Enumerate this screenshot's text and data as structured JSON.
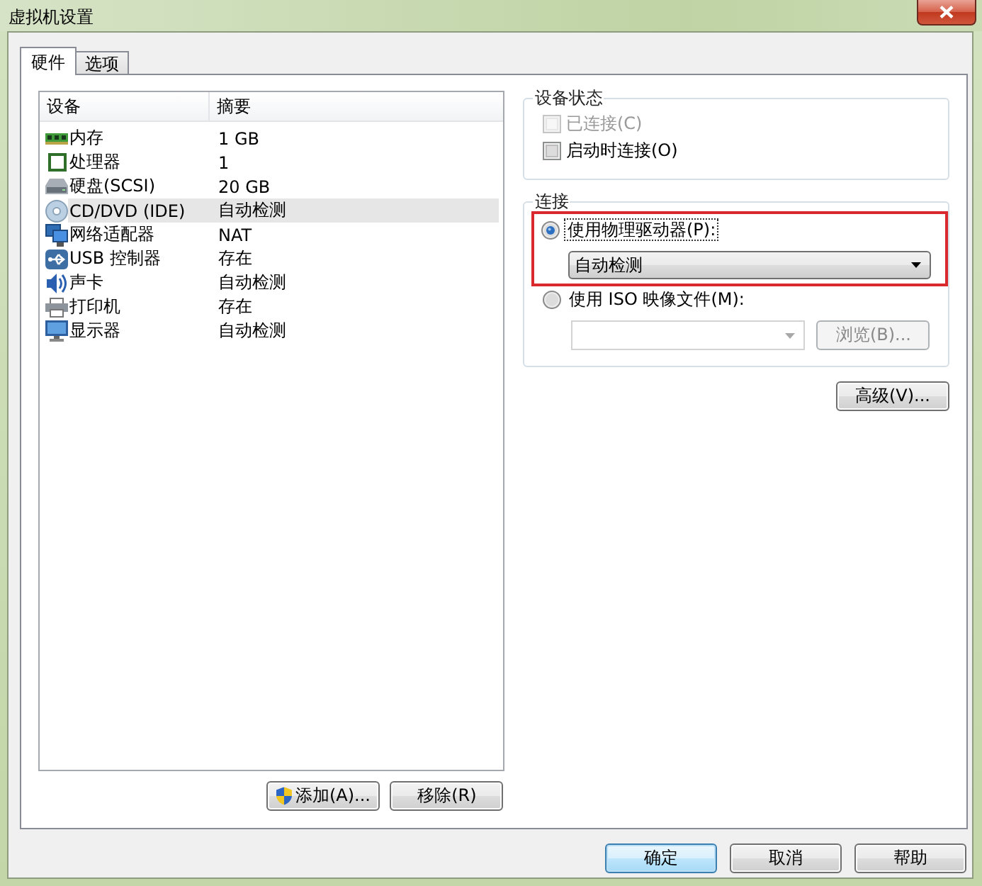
{
  "window": {
    "title": "虚拟机设置"
  },
  "tabs": [
    {
      "label": "硬件",
      "selected": true
    },
    {
      "label": "选项",
      "selected": false
    }
  ],
  "device_list": {
    "columns": [
      "设备",
      "摘要"
    ],
    "rows": [
      {
        "kind": "memory",
        "device": "内存",
        "summary": "1 GB",
        "selected": false
      },
      {
        "kind": "cpu",
        "device": "处理器",
        "summary": "1",
        "selected": false
      },
      {
        "kind": "disk",
        "device": "硬盘(SCSI)",
        "summary": "20 GB",
        "selected": false
      },
      {
        "kind": "cdrom",
        "device": "CD/DVD (IDE)",
        "summary": "自动检测",
        "selected": true
      },
      {
        "kind": "network",
        "device": "网络适配器",
        "summary": "NAT",
        "selected": false
      },
      {
        "kind": "usb",
        "device": "USB 控制器",
        "summary": "存在",
        "selected": false
      },
      {
        "kind": "sound",
        "device": "声卡",
        "summary": "自动检测",
        "selected": false
      },
      {
        "kind": "printer",
        "device": "打印机",
        "summary": "存在",
        "selected": false
      },
      {
        "kind": "display",
        "device": "显示器",
        "summary": "自动检测",
        "selected": false
      }
    ]
  },
  "device_buttons": [
    {
      "kind": "admin",
      "label": "添加(A)..."
    },
    {
      "kind": "plain",
      "label": "移除(R)"
    }
  ],
  "device_status": {
    "title": "设备状态",
    "options": [
      {
        "label": "已连接(C)",
        "checked": false,
        "disabled": true
      },
      {
        "label": "启动时连接(O)",
        "checked": false,
        "disabled": false
      }
    ]
  },
  "connection": {
    "title": "连接",
    "options": [
      {
        "kind": "drive",
        "label": "使用物理驱动器(P):",
        "selected": true,
        "focused": true,
        "highlighted": true,
        "dropdown": {
          "value": "自动检测",
          "disabled": false
        }
      },
      {
        "kind": "iso",
        "label": "使用 ISO 映像文件(M):",
        "selected": false,
        "focused": false,
        "highlighted": false,
        "dropdown": {
          "disabled": true
        },
        "browse_button": {
          "label": "浏览(B)...",
          "disabled": true
        }
      }
    ]
  },
  "advanced_button": {
    "label": "高级(V)..."
  },
  "dialog_buttons": [
    {
      "label": "确定",
      "default": true
    },
    {
      "label": "取消",
      "default": false
    },
    {
      "label": "帮助",
      "default": false
    }
  ]
}
